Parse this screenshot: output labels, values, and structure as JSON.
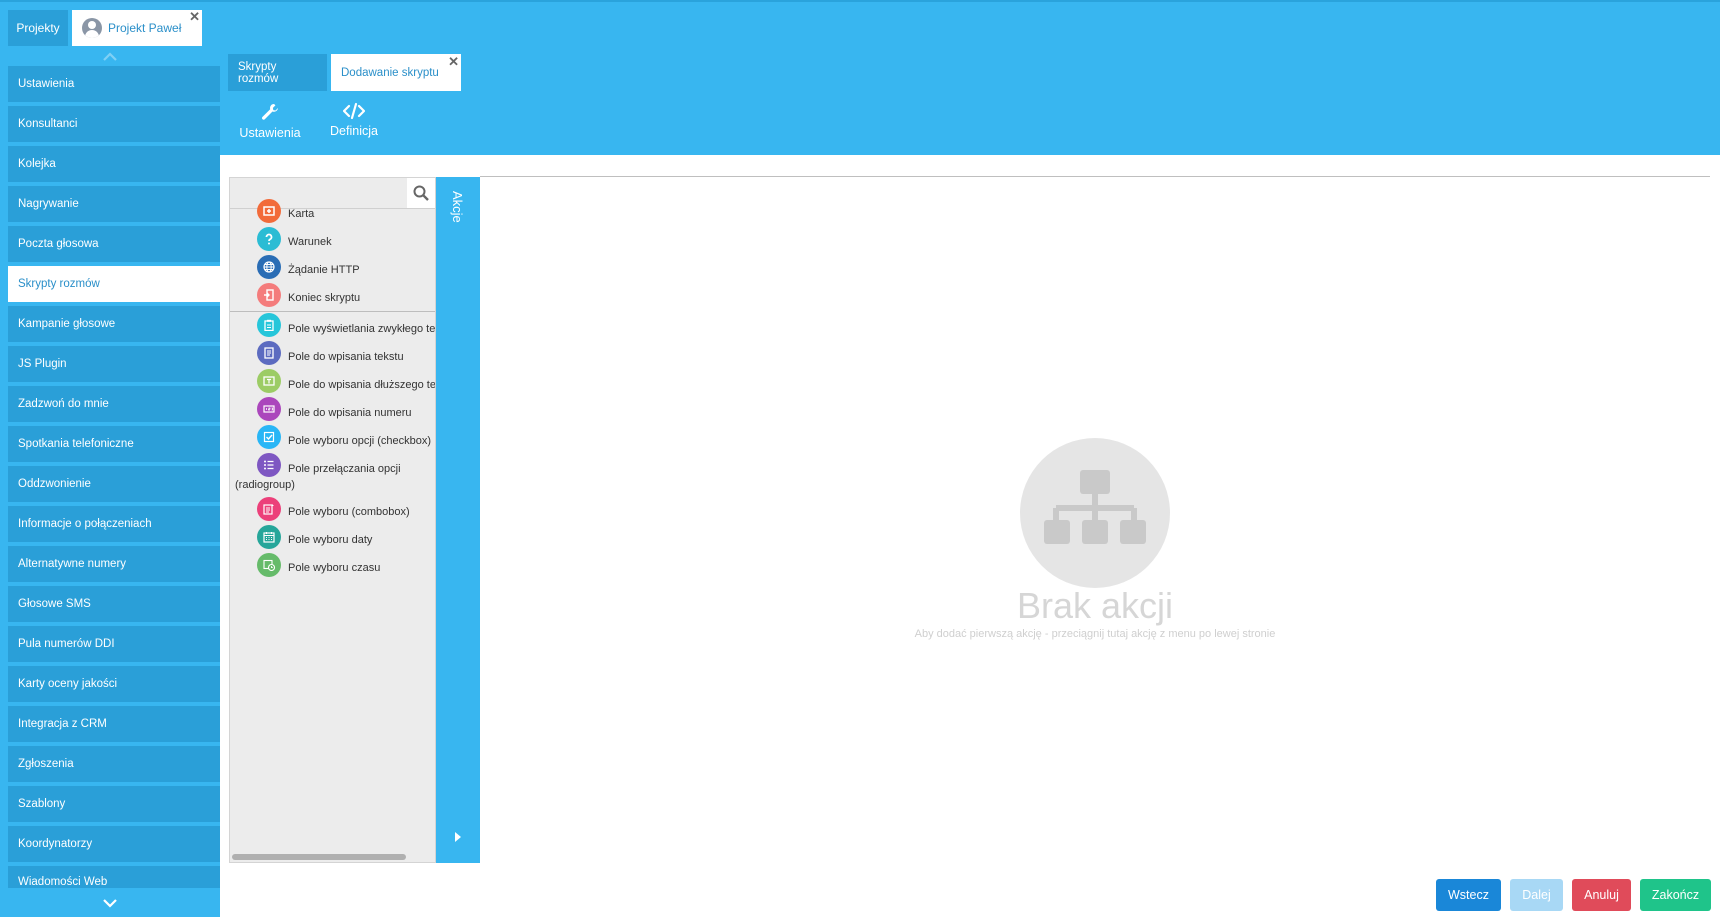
{
  "project_tabs": [
    {
      "label": "Projekty"
    },
    {
      "label": "Projekt Paweł"
    }
  ],
  "sidebar": {
    "items": [
      {
        "label": "Ustawienia"
      },
      {
        "label": "Konsultanci"
      },
      {
        "label": "Kolejka"
      },
      {
        "label": "Nagrywanie"
      },
      {
        "label": "Poczta głosowa"
      },
      {
        "label": "Skrypty rozmów"
      },
      {
        "label": "Kampanie głosowe"
      },
      {
        "label": "JS Plugin"
      },
      {
        "label": "Zadzwoń do mnie"
      },
      {
        "label": "Spotkania telefoniczne"
      },
      {
        "label": "Oddzwonienie"
      },
      {
        "label": "Informacje o połączeniach"
      },
      {
        "label": "Alternatywne numery"
      },
      {
        "label": "Głosowe SMS"
      },
      {
        "label": "Pula numerów DDI"
      },
      {
        "label": "Karty oceny jakości"
      },
      {
        "label": "Integracja z CRM"
      },
      {
        "label": "Zgłoszenia"
      },
      {
        "label": "Szablony"
      },
      {
        "label": "Koordynatorzy"
      },
      {
        "label": "Wiadomości Web"
      }
    ],
    "active": "Skrypty rozmów"
  },
  "sub_tabs": [
    {
      "label": "Skrypty rozmów"
    },
    {
      "label": "Dodawanie skryptu"
    }
  ],
  "toolbar": {
    "settings_label": "Ustawienia",
    "definition_label": "Definicja"
  },
  "actions_panel": {
    "search_value": "",
    "strip_label": "Akcje",
    "groups": [
      [
        {
          "label": "Karta",
          "icon": "card-icon",
          "color": "#f26b3a"
        },
        {
          "label": "Warunek",
          "icon": "question-icon",
          "color": "#2bbcd4"
        },
        {
          "label": "Żądanie HTTP",
          "icon": "globe-icon",
          "color": "#2a6db5"
        },
        {
          "label": "Koniec skryptu",
          "icon": "exit-icon",
          "color": "#f47c7c"
        }
      ],
      [
        {
          "label": "Pole wyświetlania zwykłego tekstu",
          "icon": "clipboard-icon",
          "color": "#26c6da"
        },
        {
          "label": "Pole do wpisania tekstu",
          "icon": "text-doc-icon",
          "color": "#5c6bc0"
        },
        {
          "label": "Pole do wpisania dłuższego tekstu",
          "icon": "textarea-icon",
          "color": "#9ccc65"
        },
        {
          "label": "Pole do wpisania numeru",
          "icon": "number-icon",
          "color": "#ab47bc"
        },
        {
          "label": "Pole wyboru opcji (checkbox)",
          "icon": "checkbox-icon",
          "color": "#29b6f6"
        },
        {
          "label": "Pole przełączania opcji",
          "label2": "(radiogroup)",
          "icon": "list-icon",
          "color": "#7e57c2"
        },
        {
          "label": "Pole wyboru (combobox)",
          "icon": "combobox-icon",
          "color": "#ec407a"
        },
        {
          "label": "Pole wyboru daty",
          "icon": "calendar-icon",
          "color": "#26a69a"
        },
        {
          "label": "Pole wyboru czasu",
          "icon": "clock-icon",
          "color": "#66bb6a"
        }
      ]
    ]
  },
  "canvas": {
    "empty_title": "Brak akcji",
    "empty_hint": "Aby dodać pierwszą akcję - przeciągnij tutaj akcję z menu po lewej stronie",
    "empty_icon": "sitemap-icon"
  },
  "footer_buttons": {
    "back": "Wstecz",
    "next": "Dalej",
    "cancel": "Anuluj",
    "finish": "Zakończ"
  },
  "colors": {
    "accent": "#38b6f0",
    "accent_dark": "#2a9fd8",
    "back_button": "#1a87d8",
    "next_button": "#a8d8f5",
    "cancel_button": "#e04b5a",
    "finish_button": "#1fc48a"
  }
}
